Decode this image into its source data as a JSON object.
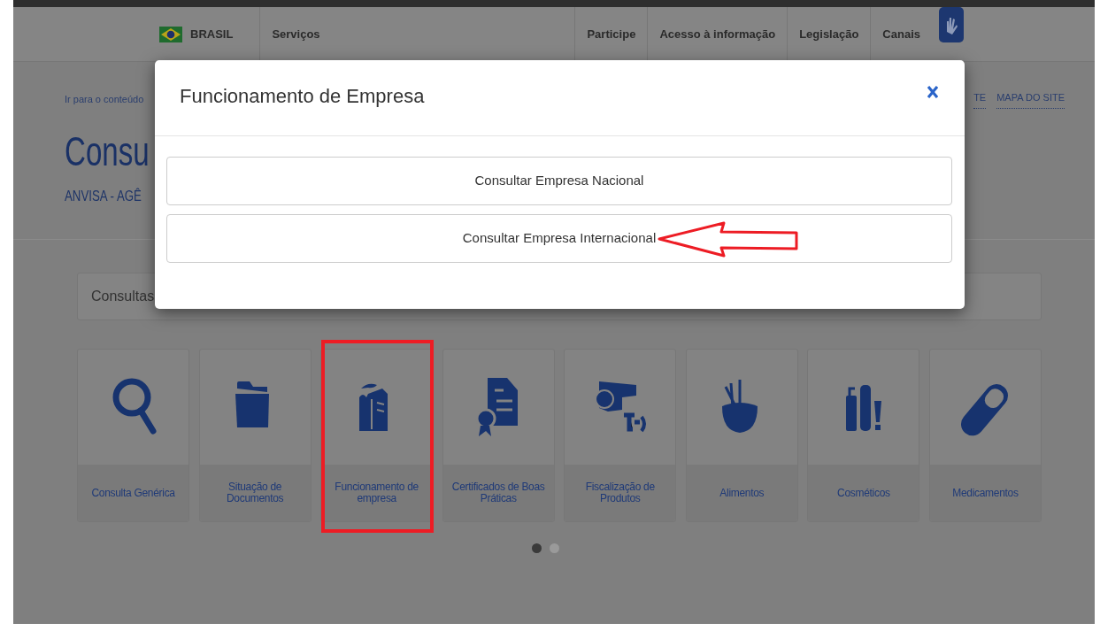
{
  "header": {
    "country": "BRASIL",
    "nav_left": [
      "Serviços"
    ],
    "nav_right": [
      "Participe",
      "Acesso à informação",
      "Legislação",
      "Canais"
    ]
  },
  "skip_link": "Ir para o conteúdo",
  "top_links": [
    "TE",
    "MAPA DO SITE"
  ],
  "page_title": "Consu",
  "subtitle": "ANVISA - AGÊ",
  "search": {
    "placeholder": "Consultas"
  },
  "tiles": [
    {
      "label": "Consulta Genérica",
      "marked": false
    },
    {
      "label": "Situação de Documentos",
      "marked": false
    },
    {
      "label": "Funcionamento de empresa",
      "marked": true
    },
    {
      "label": "Certificados de Boas Práticas",
      "marked": false
    },
    {
      "label": "Fiscalização de Produtos",
      "marked": false
    },
    {
      "label": "Alimentos",
      "marked": false
    },
    {
      "label": "Cosméticos",
      "marked": false
    },
    {
      "label": "Medicamentos",
      "marked": false
    }
  ],
  "carousel": [
    {
      "selected": true
    },
    {
      "selected": false
    }
  ],
  "modal": {
    "title": "Funcionamento de Empresa",
    "buttons": [
      {
        "label": "Consultar Empresa Nacional",
        "marked": false
      },
      {
        "label": "Consultar Empresa Internacional",
        "marked": true
      }
    ]
  }
}
